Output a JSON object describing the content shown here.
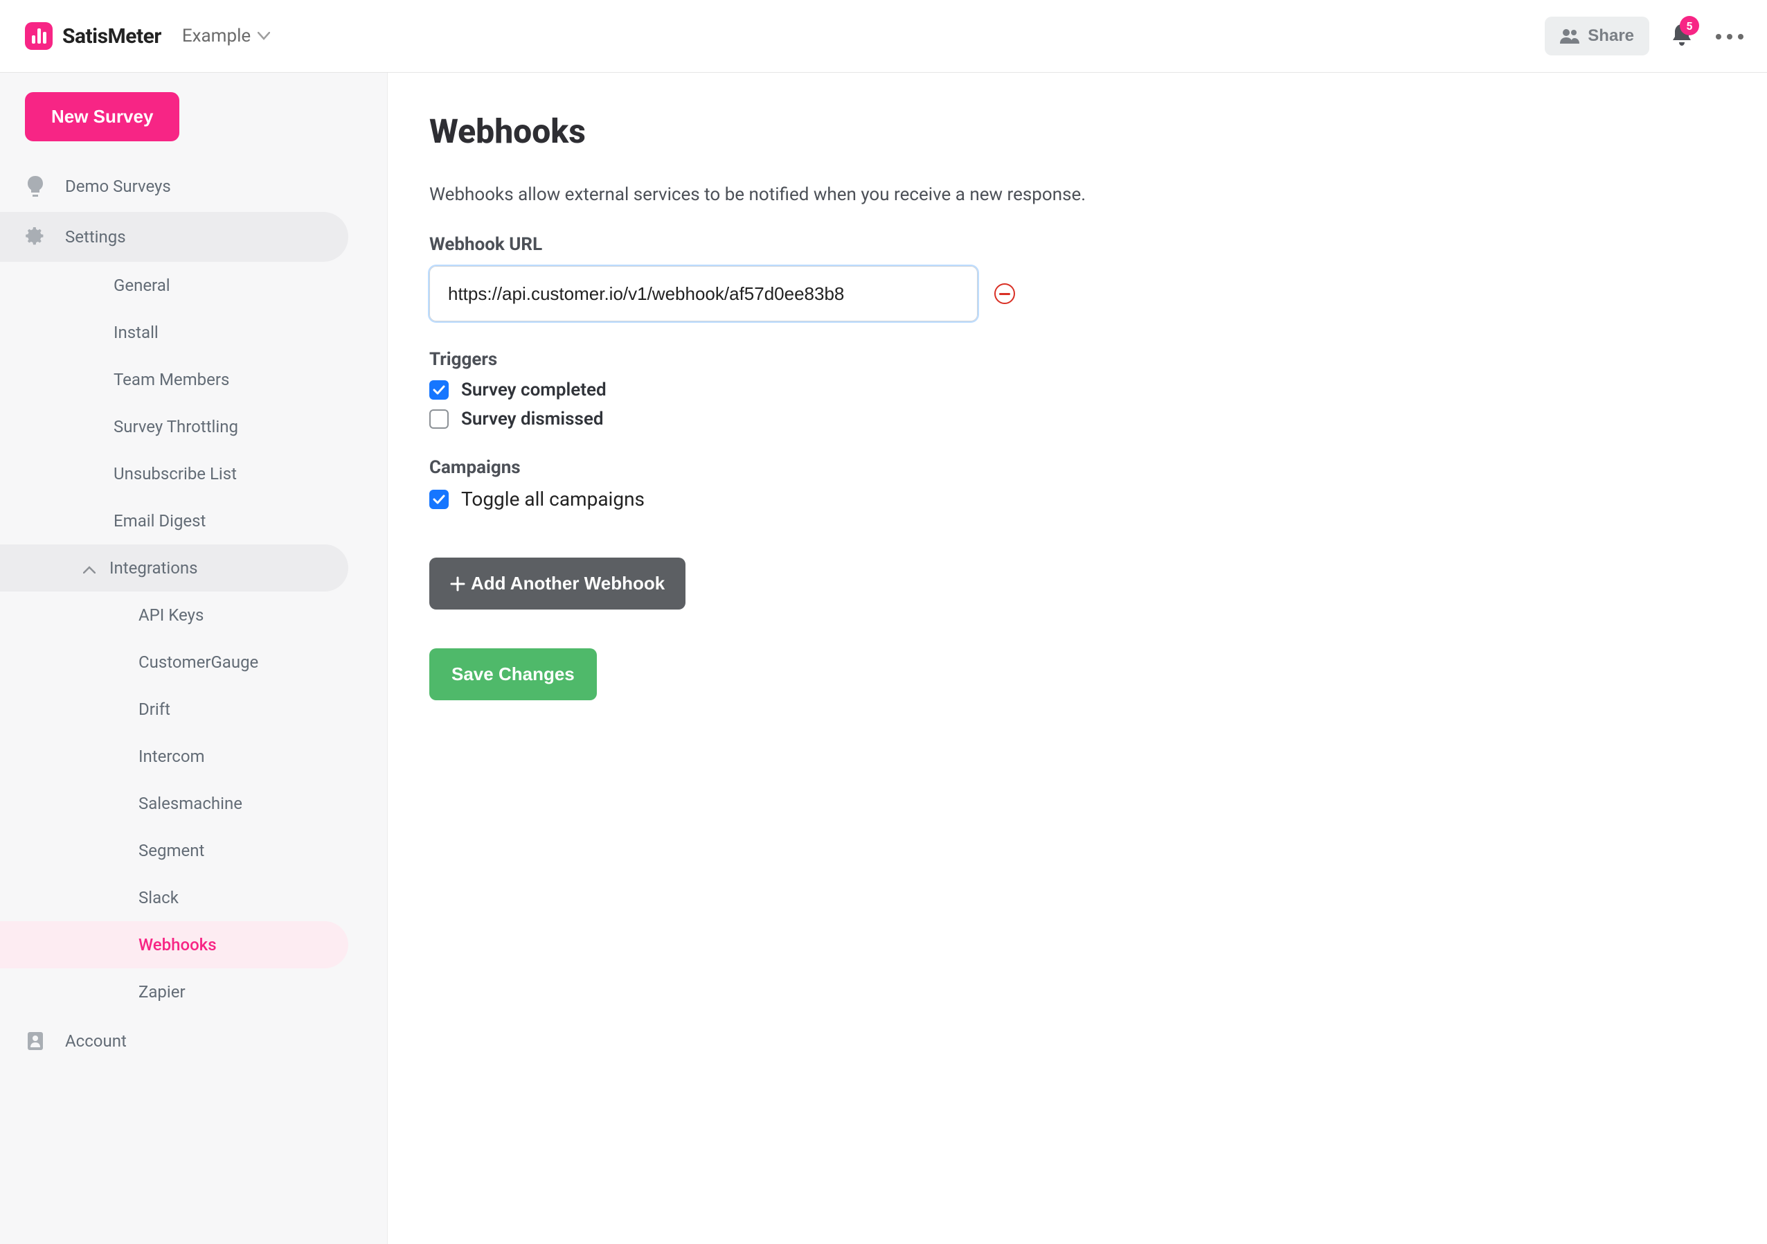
{
  "header": {
    "brand": "SatisMeter",
    "workspace": "Example",
    "share_label": "Share",
    "notification_count": "5"
  },
  "sidebar": {
    "new_survey": "New Survey",
    "demo_surveys": "Demo Surveys",
    "settings": "Settings",
    "settings_children": {
      "general": "General",
      "install": "Install",
      "team_members": "Team Members",
      "survey_throttling": "Survey Throttling",
      "unsubscribe_list": "Unsubscribe List",
      "email_digest": "Email Digest",
      "integrations": "Integrations"
    },
    "integrations_children": {
      "api_keys": "API Keys",
      "customergauge": "CustomerGauge",
      "drift": "Drift",
      "intercom": "Intercom",
      "salesmachine": "Salesmachine",
      "segment": "Segment",
      "slack": "Slack",
      "webhooks": "Webhooks",
      "zapier": "Zapier"
    },
    "account": "Account"
  },
  "page": {
    "title": "Webhooks",
    "intro": "Webhooks allow external services to be notified when you receive a new response.",
    "url_label": "Webhook URL",
    "url_value": "https://api.customer.io/v1/webhook/af57d0ee83b8",
    "triggers_label": "Triggers",
    "trigger_completed": "Survey completed",
    "trigger_dismissed": "Survey dismissed",
    "campaigns_label": "Campaigns",
    "toggle_all": "Toggle all campaigns",
    "add_webhook": "Add Another Webhook",
    "save": "Save Changes"
  }
}
